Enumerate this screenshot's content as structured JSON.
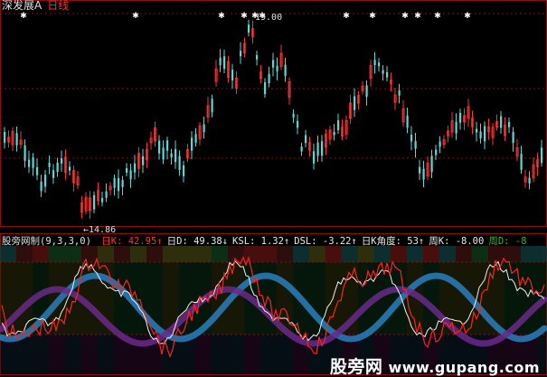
{
  "header": {
    "stock_name": "深发展A",
    "period": "日线"
  },
  "price_chart": {
    "high_label": "19.00",
    "low_label": "←14.86",
    "signal_marks_top": [
      "✱",
      "✦",
      "✱",
      "✦",
      "✱✱",
      "✱",
      "✱",
      "✦",
      "✱",
      "✱",
      "✱"
    ]
  },
  "indicator": {
    "name": "股旁网制(9,3,3,0)",
    "fields": [
      {
        "label": "日K:",
        "value": "42.95",
        "arrow": "↑",
        "color": "#ff3030"
      },
      {
        "label": "日D:",
        "value": "49.38",
        "arrow": "↓",
        "color": "#e8e8e8"
      },
      {
        "label": "KSL:",
        "value": "1.32",
        "arrow": "↑",
        "color": "#e8e8e8"
      },
      {
        "label": "DSL:",
        "value": "-3.22",
        "arrow": "↑",
        "color": "#e8e8e8"
      },
      {
        "label": "日K角度:",
        "value": "53",
        "arrow": "↑",
        "color": "#e8e8e8"
      },
      {
        "label": "周K:",
        "value": "-8.00",
        "arrow": "",
        "color": "#e8e8e8"
      },
      {
        "label": "周D:",
        "value": "-8",
        "arrow": "",
        "color": "#20c020"
      }
    ]
  },
  "watermark": {
    "cn": "股旁网",
    "site": "www.gupang.com"
  },
  "colors": {
    "up": "#ff3232",
    "down": "#5fd6d6",
    "grid": "#8a1010",
    "k_line": "#ff2020",
    "d_line": "#f0f0f0",
    "band_blue": "#2a7fc0",
    "band_purple": "#6a2a8a"
  }
}
